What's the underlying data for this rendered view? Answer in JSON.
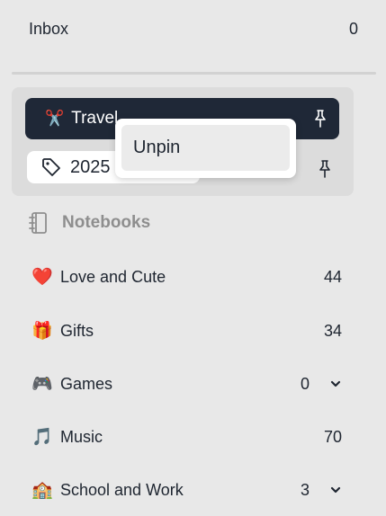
{
  "inbox": {
    "label": "Inbox",
    "count": "0"
  },
  "pinned": {
    "travel": {
      "emoji": "✂️",
      "label": "Travel"
    },
    "tag": {
      "label": "2025"
    }
  },
  "context_menu": {
    "unpin_label": "Unpin"
  },
  "notebooks": {
    "header": "Notebooks",
    "items": [
      {
        "emoji": "❤️",
        "label": "Love and Cute",
        "count": "44"
      },
      {
        "emoji": "🎁",
        "label": "Gifts",
        "count": "34"
      },
      {
        "emoji": "🎮",
        "label": "Games",
        "count": "0",
        "expandable": true
      },
      {
        "emoji": "🎵",
        "label": "Music",
        "count": "70"
      },
      {
        "emoji": "🏫",
        "label": "School and Work",
        "count": "3",
        "expandable": true
      }
    ]
  },
  "colors": {
    "selected_bg": "#1f2837",
    "panel_bg": "#dcdcdc",
    "sidebar_bg": "#e8e8e8"
  }
}
